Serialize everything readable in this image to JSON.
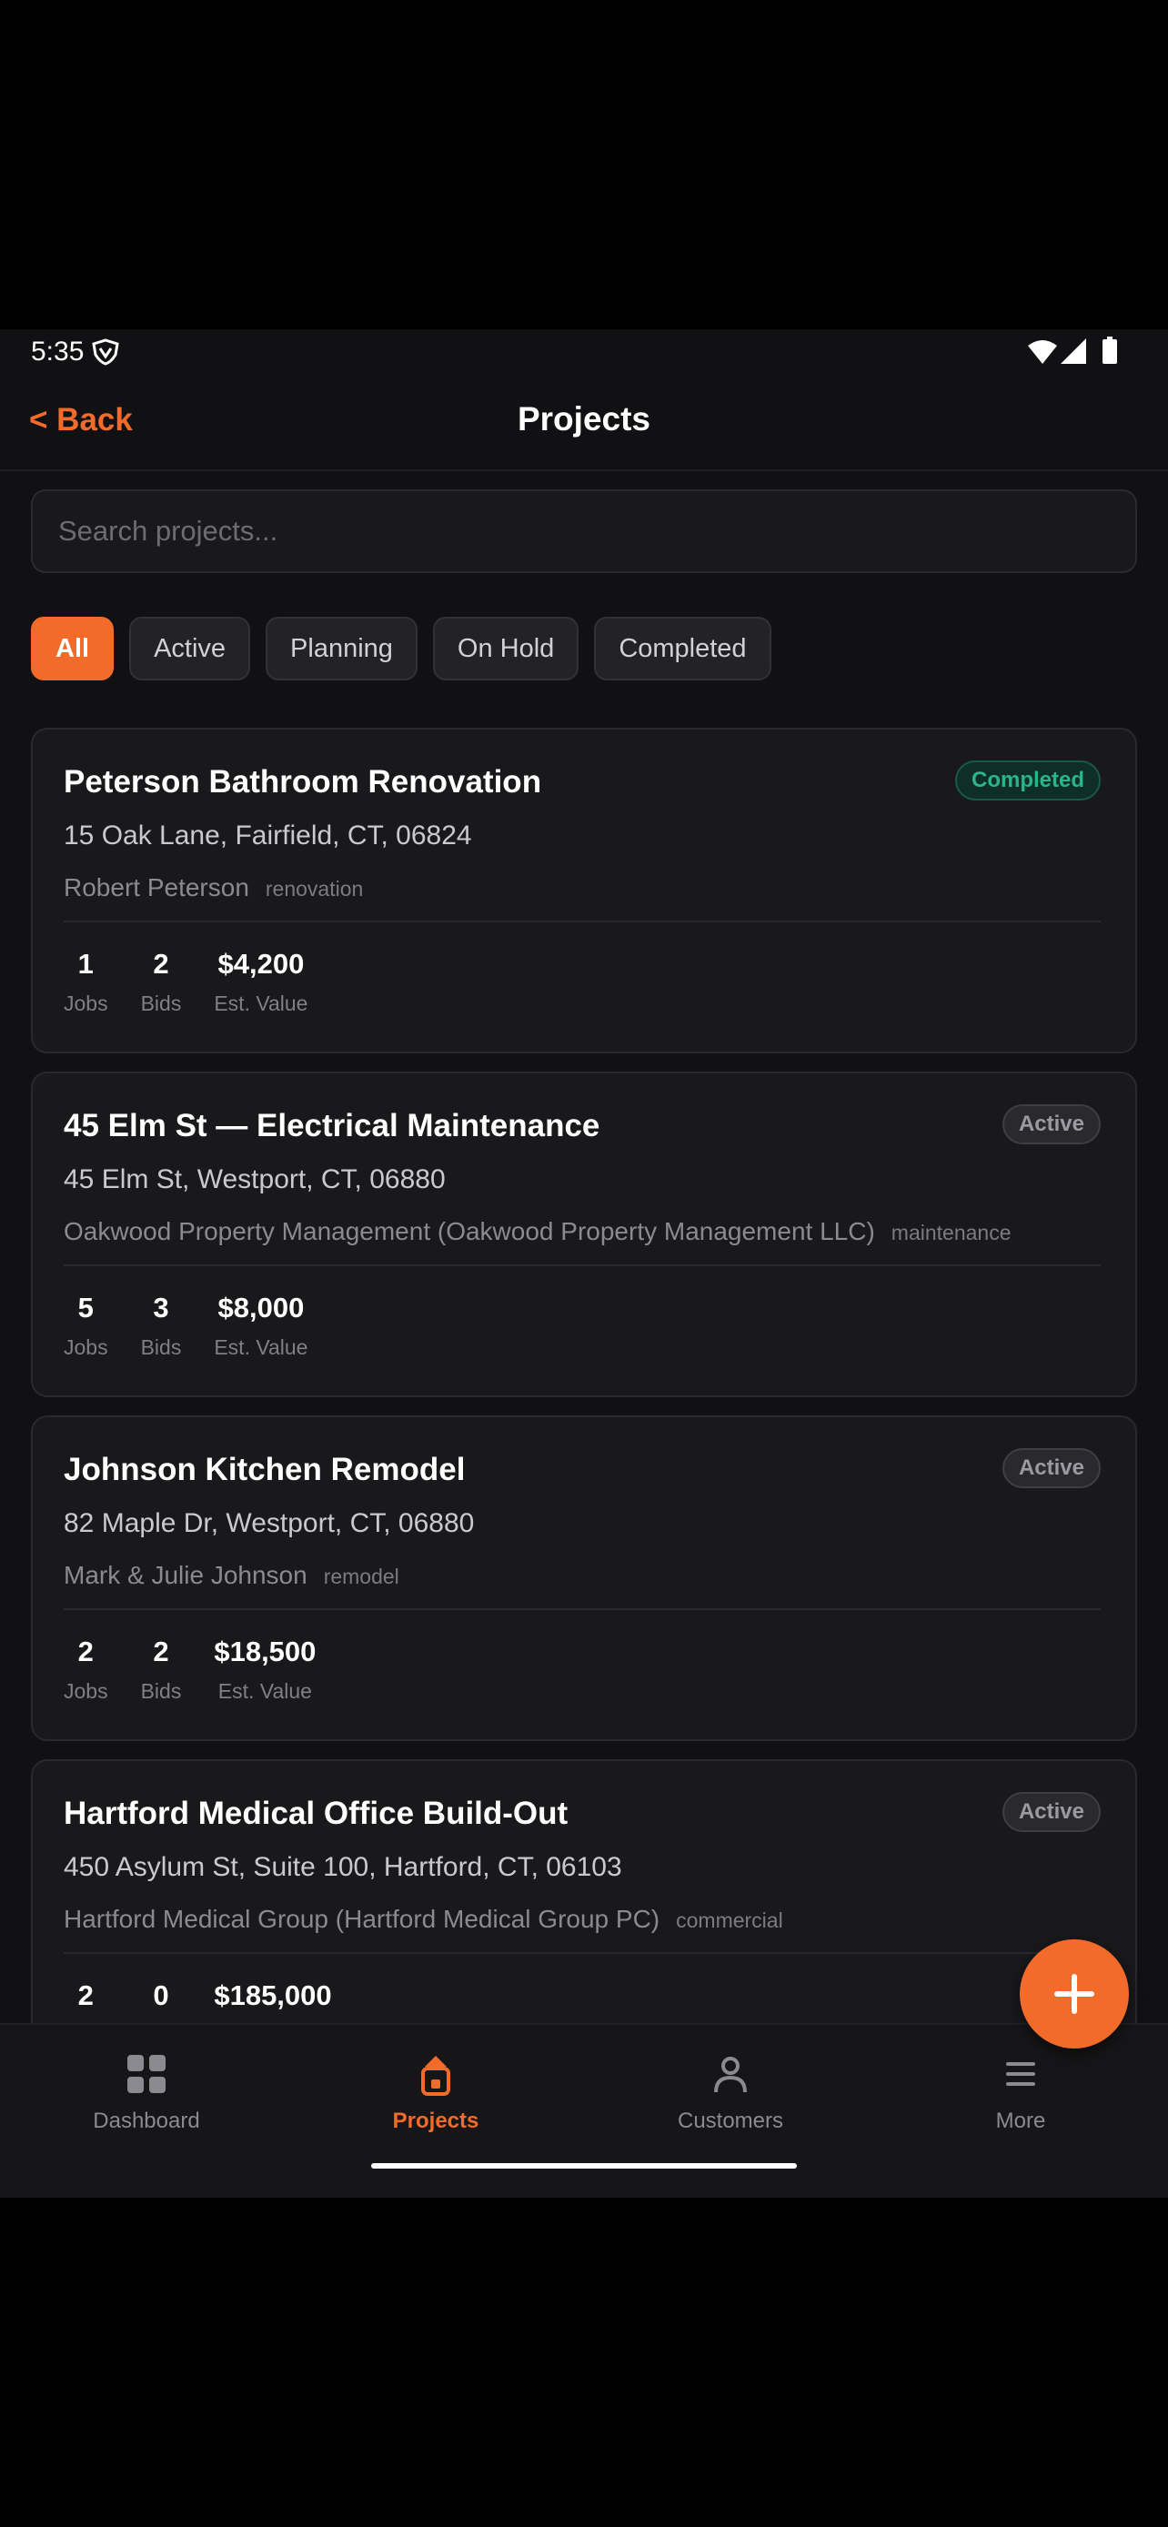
{
  "status_bar": {
    "time": "5:35"
  },
  "header": {
    "back_label": "< Back",
    "title": "Projects"
  },
  "search": {
    "placeholder": "Search projects...",
    "value": ""
  },
  "filters": [
    "All",
    "Active",
    "Planning",
    "On Hold",
    "Completed"
  ],
  "selected_filter": "All",
  "projects": [
    {
      "name": "Peterson Bathroom Renovation",
      "status": "Completed",
      "address": "15 Oak Lane, Fairfield, CT, 06824",
      "customer": "Robert Peterson",
      "type": "renovation",
      "jobs": "1",
      "bids": "2",
      "value": "$4,200"
    },
    {
      "name": "45 Elm St — Electrical Maintenance",
      "status": "Active",
      "address": "45 Elm St, Westport, CT, 06880",
      "customer": "Oakwood Property Management (Oakwood Property Management LLC)",
      "type": "maintenance",
      "jobs": "5",
      "bids": "3",
      "value": "$8,000"
    },
    {
      "name": "Johnson Kitchen Remodel",
      "status": "Active",
      "address": "82 Maple Dr, Westport, CT, 06880",
      "customer": "Mark & Julie Johnson",
      "type": "remodel",
      "jobs": "2",
      "bids": "2",
      "value": "$18,500"
    },
    {
      "name": "Hartford Medical Office Build-Out",
      "status": "Active",
      "address": "450 Asylum St, Suite 100, Hartford, CT, 06103",
      "customer": "Hartford Medical Group (Hartford Medical Group PC)",
      "type": "commercial",
      "jobs": "2",
      "bids": "0",
      "value": "$185,000"
    }
  ],
  "stat_labels": {
    "jobs": "Jobs",
    "bids": "Bids",
    "value": "Est. Value"
  },
  "bottom_nav": [
    {
      "label": "Dashboard",
      "icon": "grid-icon"
    },
    {
      "label": "Projects",
      "icon": "clipboard-icon"
    },
    {
      "label": "Customers",
      "icon": "person-icon"
    },
    {
      "label": "More",
      "icon": "menu-icon"
    }
  ],
  "current_nav": "Projects",
  "fab": {
    "icon": "plus-icon"
  },
  "colors": {
    "accent": "#f26b2a",
    "background": "#111113",
    "card": "#19191c",
    "completed": "#2bb48a"
  }
}
